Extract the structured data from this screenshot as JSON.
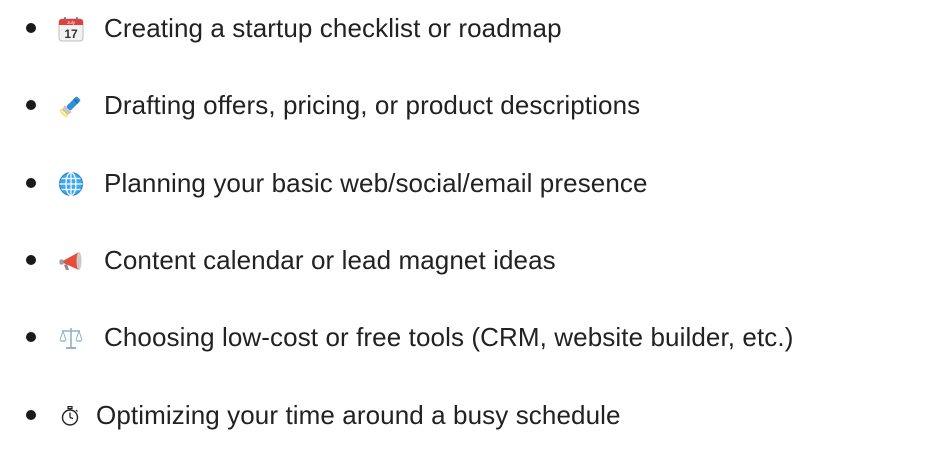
{
  "items": [
    {
      "icon": "calendar-icon",
      "label": "Creating a startup checklist or roadmap",
      "calendar_month": "July",
      "calendar_day": "17"
    },
    {
      "icon": "flashlight-icon",
      "label": "Drafting offers, pricing, or product descriptions"
    },
    {
      "icon": "globe-icon",
      "label": "Planning your basic web/social/email presence"
    },
    {
      "icon": "megaphone-icon",
      "label": "Content calendar or lead magnet ideas"
    },
    {
      "icon": "scales-icon",
      "label": "Choosing low-cost or free tools (CRM, website builder, etc.)"
    },
    {
      "icon": "stopwatch-icon",
      "label": "Optimizing your time around a busy schedule"
    }
  ],
  "colors": {
    "text": "#222222",
    "bullet": "#1a1a1a",
    "calendar_red": "#e43b3b",
    "globe_blue": "#2e9be6",
    "megaphone_red": "#e94b3c"
  }
}
